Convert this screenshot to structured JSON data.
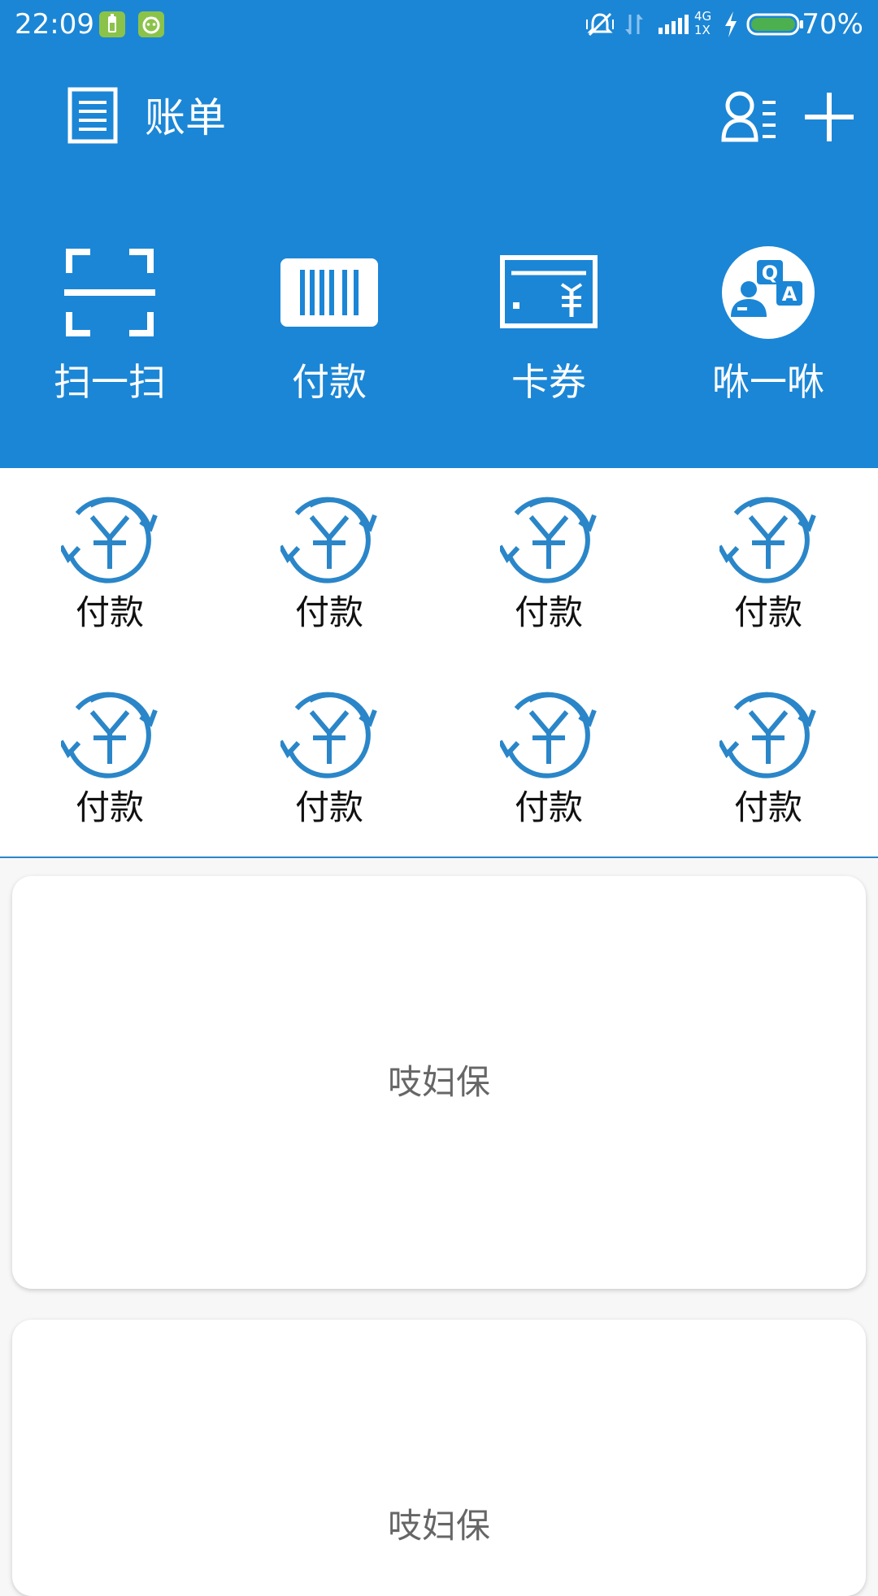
{
  "status_bar": {
    "time": "22:09",
    "battery": "70%",
    "network_label_top": "4G",
    "network_label_bottom": "1X"
  },
  "header": {
    "title": "账单",
    "left_icon": "bill-list-icon",
    "right_icons": [
      "contacts-icon",
      "add-icon"
    ]
  },
  "quick_actions": [
    {
      "label": "扫一扫",
      "icon": "scan-icon"
    },
    {
      "label": "付款",
      "icon": "barcode-icon"
    },
    {
      "label": "卡券",
      "icon": "card-coupon-icon"
    },
    {
      "label": "咻一咻",
      "icon": "qa-chat-icon"
    }
  ],
  "grid": [
    {
      "label": "付款",
      "icon": "yuan-refresh-icon"
    },
    {
      "label": "付款",
      "icon": "yuan-refresh-icon"
    },
    {
      "label": "付款",
      "icon": "yuan-refresh-icon"
    },
    {
      "label": "付款",
      "icon": "yuan-refresh-icon"
    },
    {
      "label": "付款",
      "icon": "yuan-refresh-icon"
    },
    {
      "label": "付款",
      "icon": "yuan-refresh-icon"
    },
    {
      "label": "付款",
      "icon": "yuan-refresh-icon"
    },
    {
      "label": "付款",
      "icon": "yuan-refresh-icon"
    }
  ],
  "cards": [
    {
      "text": "吱妇保"
    },
    {
      "text": "吱妇保"
    }
  ],
  "colors": {
    "primary": "#1b86d6",
    "icon_blue": "#2a86c8",
    "white": "#ffffff",
    "battery_green": "#4caf50"
  }
}
